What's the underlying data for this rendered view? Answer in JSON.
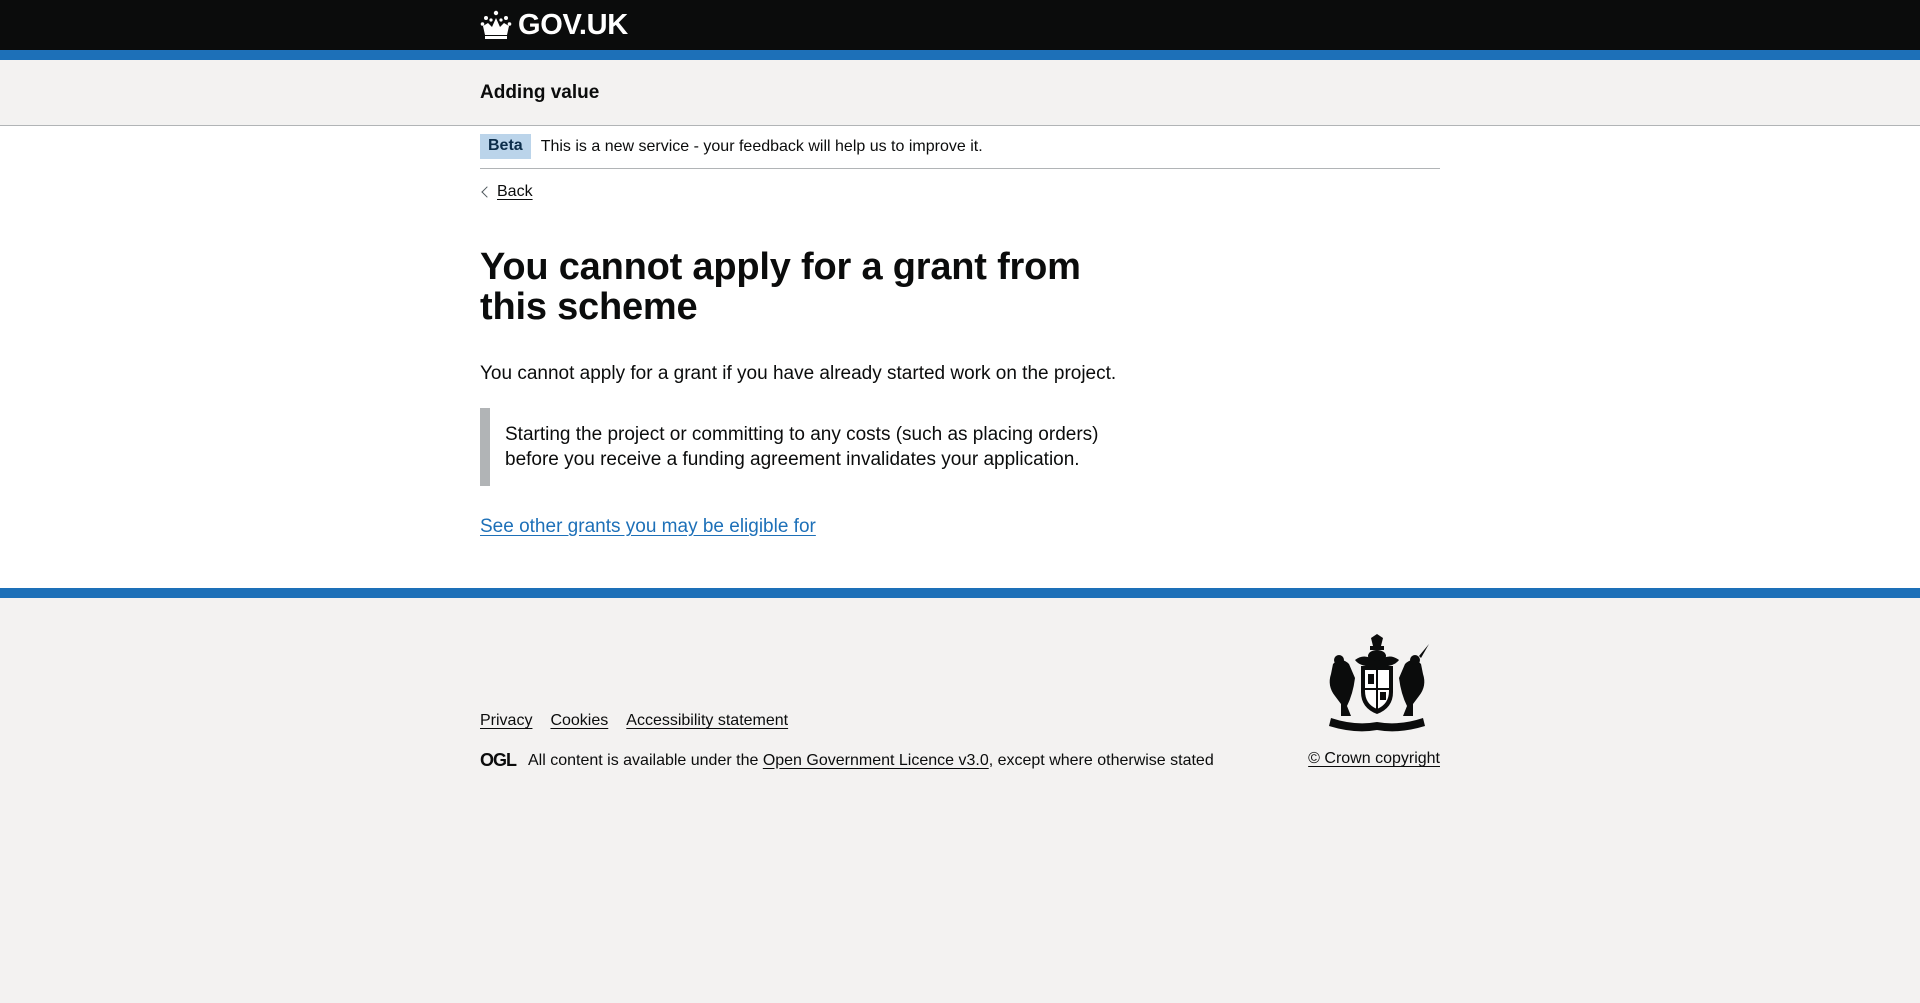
{
  "header": {
    "logo_text": "GOV.UK",
    "logo_icon": "crown-icon",
    "brand_blue": "#1d70b8"
  },
  "service": {
    "name": "Adding value"
  },
  "phase_banner": {
    "tag": "Beta",
    "text": "This is a new service - your feedback will help us to improve it."
  },
  "main": {
    "back_label": "Back",
    "title": "You cannot apply for a grant from this scheme",
    "body": "You cannot apply for a grant if you have already started work on the project.",
    "inset": "Starting the project or committing to any costs (such as placing orders) before you receive a funding agreement invalidates your application.",
    "link": "See other grants you may be eligible for"
  },
  "footer": {
    "links": [
      "Privacy",
      "Cookies",
      "Accessibility statement"
    ],
    "ogl_logo": "OGL",
    "licence_prefix": "All content is available under the ",
    "licence_link": "Open Government Licence v3.0",
    "licence_suffix": ", except where otherwise stated",
    "crest_icon": "royal-coat-of-arms-icon",
    "copyright": "© Crown copyright"
  }
}
